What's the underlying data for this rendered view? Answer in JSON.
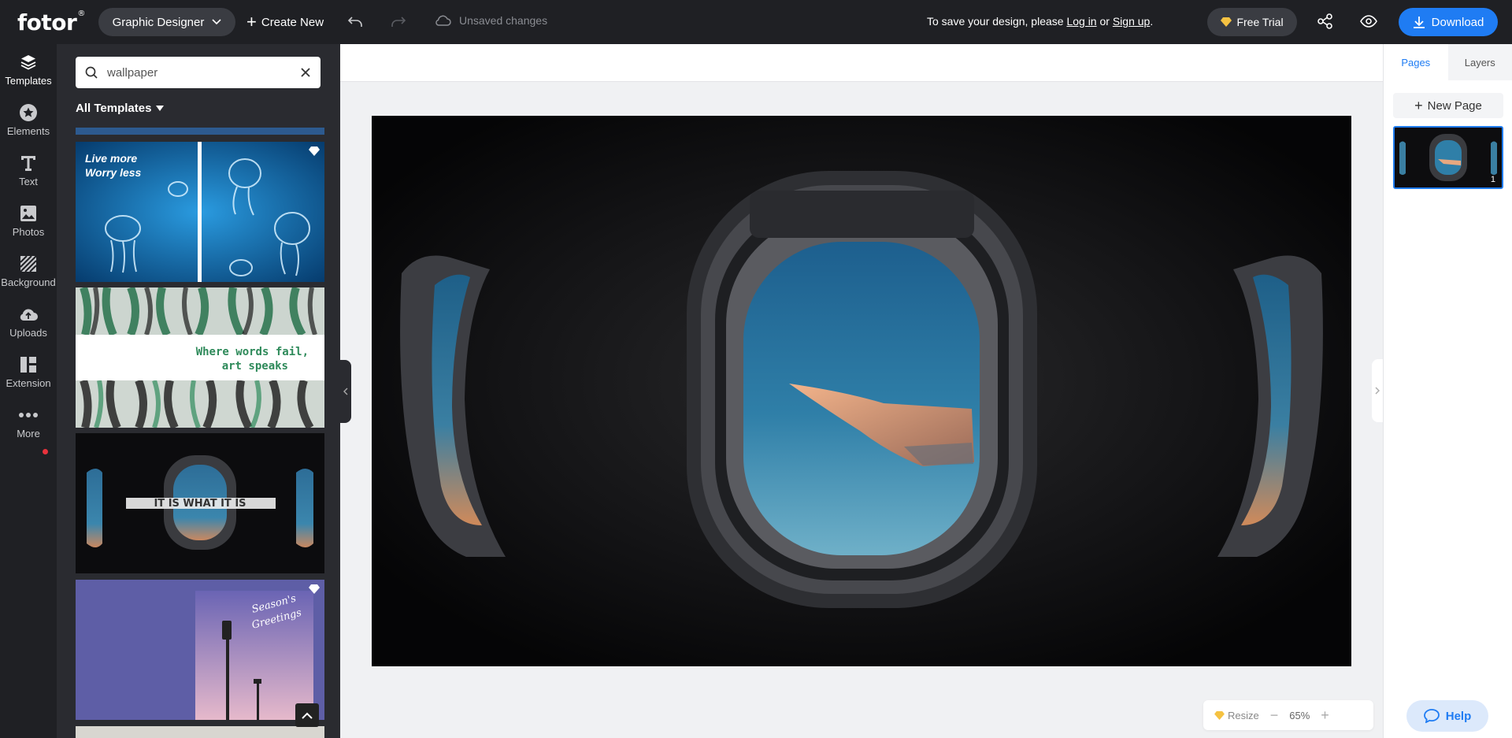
{
  "topbar": {
    "logo": "fotor",
    "logo_mark": "®",
    "designer_label": "Graphic Designer",
    "create_label": "Create New",
    "unsaved_label": "Unsaved changes",
    "save_prefix": "To save your design, please",
    "login_label": "Log in",
    "or_label": "or",
    "signup_label": "Sign up",
    "period": ".",
    "free_trial_label": "Free Trial",
    "download_label": "Download"
  },
  "rail": {
    "items": [
      {
        "label": "Templates",
        "icon": "layers-icon"
      },
      {
        "label": "Elements",
        "icon": "star-circle-icon"
      },
      {
        "label": "Text",
        "icon": "text-t-icon"
      },
      {
        "label": "Photos",
        "icon": "image-icon"
      },
      {
        "label": "Background",
        "icon": "stripes-icon"
      },
      {
        "label": "Uploads",
        "icon": "cloud-upload-icon"
      },
      {
        "label": "Extension",
        "icon": "grid-icon"
      },
      {
        "label": "More",
        "icon": "dots-icon"
      }
    ]
  },
  "panel": {
    "search_value": "wallpaper",
    "filter_label": "All Templates",
    "templates": [
      {
        "text_line1": "Live more",
        "text_line2": "Worry less",
        "premium": true
      },
      {
        "text_line1": "Where words fail,",
        "text_line2": "art speaks",
        "premium": false
      },
      {
        "text_line1": "IT IS WHAT IT IS",
        "text_line2": "",
        "premium": false
      },
      {
        "text_line1": "Season's",
        "text_line2": "Greetings",
        "premium": true
      }
    ]
  },
  "right_panel": {
    "tab_pages": "Pages",
    "tab_layers": "Layers",
    "new_page_label": "New Page",
    "page_number": "1"
  },
  "zoom": {
    "resize_label": "Resize",
    "value": "65%"
  },
  "help_label": "Help",
  "colors": {
    "accent": "#1f7cf3",
    "dark": "#1f2024",
    "panel": "#2a2b30",
    "premium": "#f5c242"
  }
}
